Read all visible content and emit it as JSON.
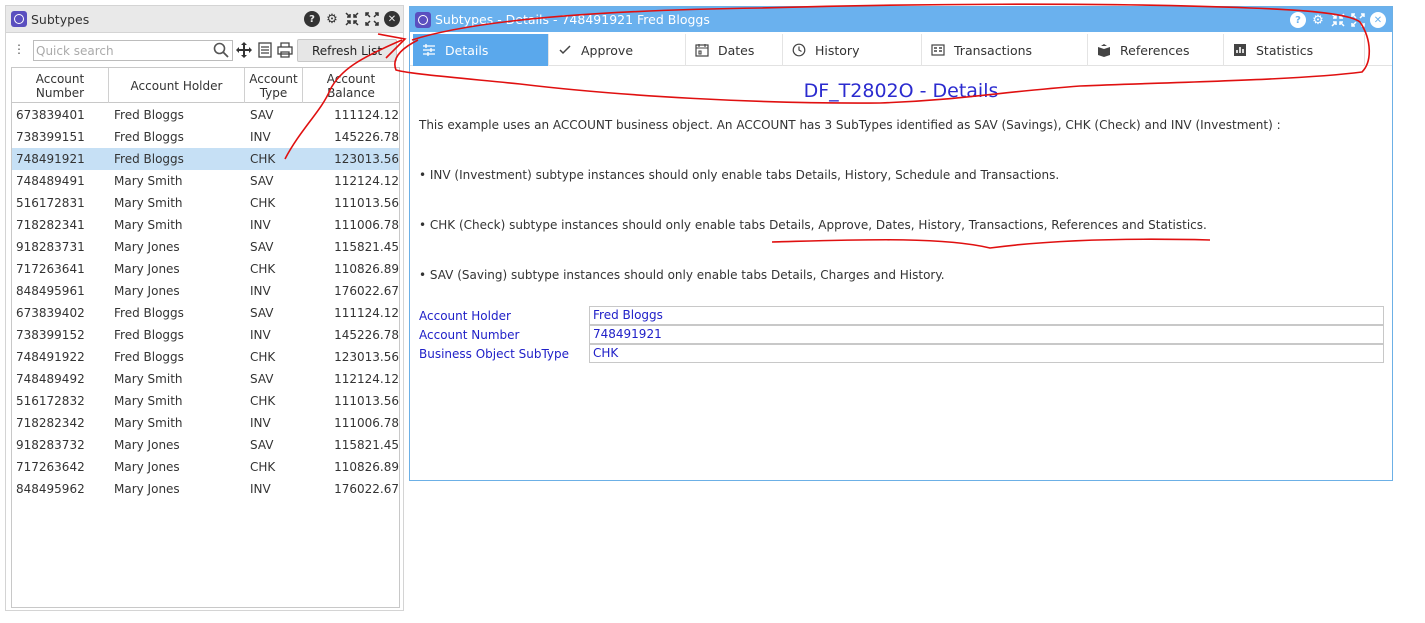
{
  "left": {
    "title": "Subtypes",
    "search_placeholder": "Quick search",
    "refresh_label": "Refresh List",
    "columns": [
      "Account\nNumber",
      "Account Holder",
      "Account\nType",
      "Account\nBalance"
    ],
    "selected_row": 2,
    "rows": [
      [
        "673839401",
        "Fred Bloggs",
        "SAV",
        "111124.12"
      ],
      [
        "738399151",
        "Fred Bloggs",
        "INV",
        "145226.78"
      ],
      [
        "748491921",
        "Fred Bloggs",
        "CHK",
        "123013.56"
      ],
      [
        "748489491",
        "Mary Smith",
        "SAV",
        "112124.12"
      ],
      [
        "516172831",
        "Mary Smith",
        "CHK",
        "111013.56"
      ],
      [
        "718282341",
        "Mary Smith",
        "INV",
        "111006.78"
      ],
      [
        "918283731",
        "Mary Jones",
        "SAV",
        "115821.45"
      ],
      [
        "717263641",
        "Mary Jones",
        "CHK",
        "110826.89"
      ],
      [
        "848495961",
        "Mary Jones",
        "INV",
        "176022.67"
      ],
      [
        "673839402",
        "Fred Bloggs",
        "SAV",
        "111124.12"
      ],
      [
        "738399152",
        "Fred Bloggs",
        "INV",
        "145226.78"
      ],
      [
        "748491922",
        "Fred Bloggs",
        "CHK",
        "123013.56"
      ],
      [
        "748489492",
        "Mary Smith",
        "SAV",
        "112124.12"
      ],
      [
        "516172832",
        "Mary Smith",
        "CHK",
        "111013.56"
      ],
      [
        "718282342",
        "Mary Smith",
        "INV",
        "111006.78"
      ],
      [
        "918283732",
        "Mary Jones",
        "SAV",
        "115821.45"
      ],
      [
        "717263642",
        "Mary Jones",
        "CHK",
        "110826.89"
      ],
      [
        "848495962",
        "Mary Jones",
        "INV",
        "176022.67"
      ]
    ]
  },
  "right": {
    "title": "Subtypes - Details - 748491921 Fred Bloggs",
    "tabs": [
      {
        "label": "Details",
        "icon": "details-icon",
        "active": true
      },
      {
        "label": "Approve",
        "icon": "check-icon",
        "active": false
      },
      {
        "label": "Dates",
        "icon": "calendar-icon",
        "active": false
      },
      {
        "label": "History",
        "icon": "clock-icon",
        "active": false
      },
      {
        "label": "Transactions",
        "icon": "transactions-icon",
        "active": false
      },
      {
        "label": "References",
        "icon": "book-icon",
        "active": false
      },
      {
        "label": "Statistics",
        "icon": "bar-chart-icon",
        "active": false
      }
    ],
    "heading": "DF_T2802O - Details",
    "intro": "This example uses an ACCOUNT business object. An ACCOUNT has 3 SubTypes identified as SAV (Savings), CHK (Check) and INV (Investment) :",
    "bullets": [
      "• INV (Investment) subtype instances should only enable tabs Details, History, Schedule and Transactions.",
      "• CHK (Check) subtype instances should only enable tabs Details, Approve, Dates, History, Transactions, References and Statistics.",
      "• SAV (Saving) subtype instances should only enable tabs Details, Charges and History."
    ],
    "fields": [
      {
        "label": "Account Holder",
        "value": "Fred Bloggs"
      },
      {
        "label": "Account Number",
        "value": "748491921"
      },
      {
        "label": "Business Object SubType",
        "value": "CHK"
      }
    ]
  },
  "colors": {
    "accent": "#6ab1ee",
    "active_tab": "#5aa8ec",
    "heading": "#2b2bcf",
    "field": "#2020c8",
    "selected_row": "#c6e0f5",
    "annotation": "#e01010"
  }
}
